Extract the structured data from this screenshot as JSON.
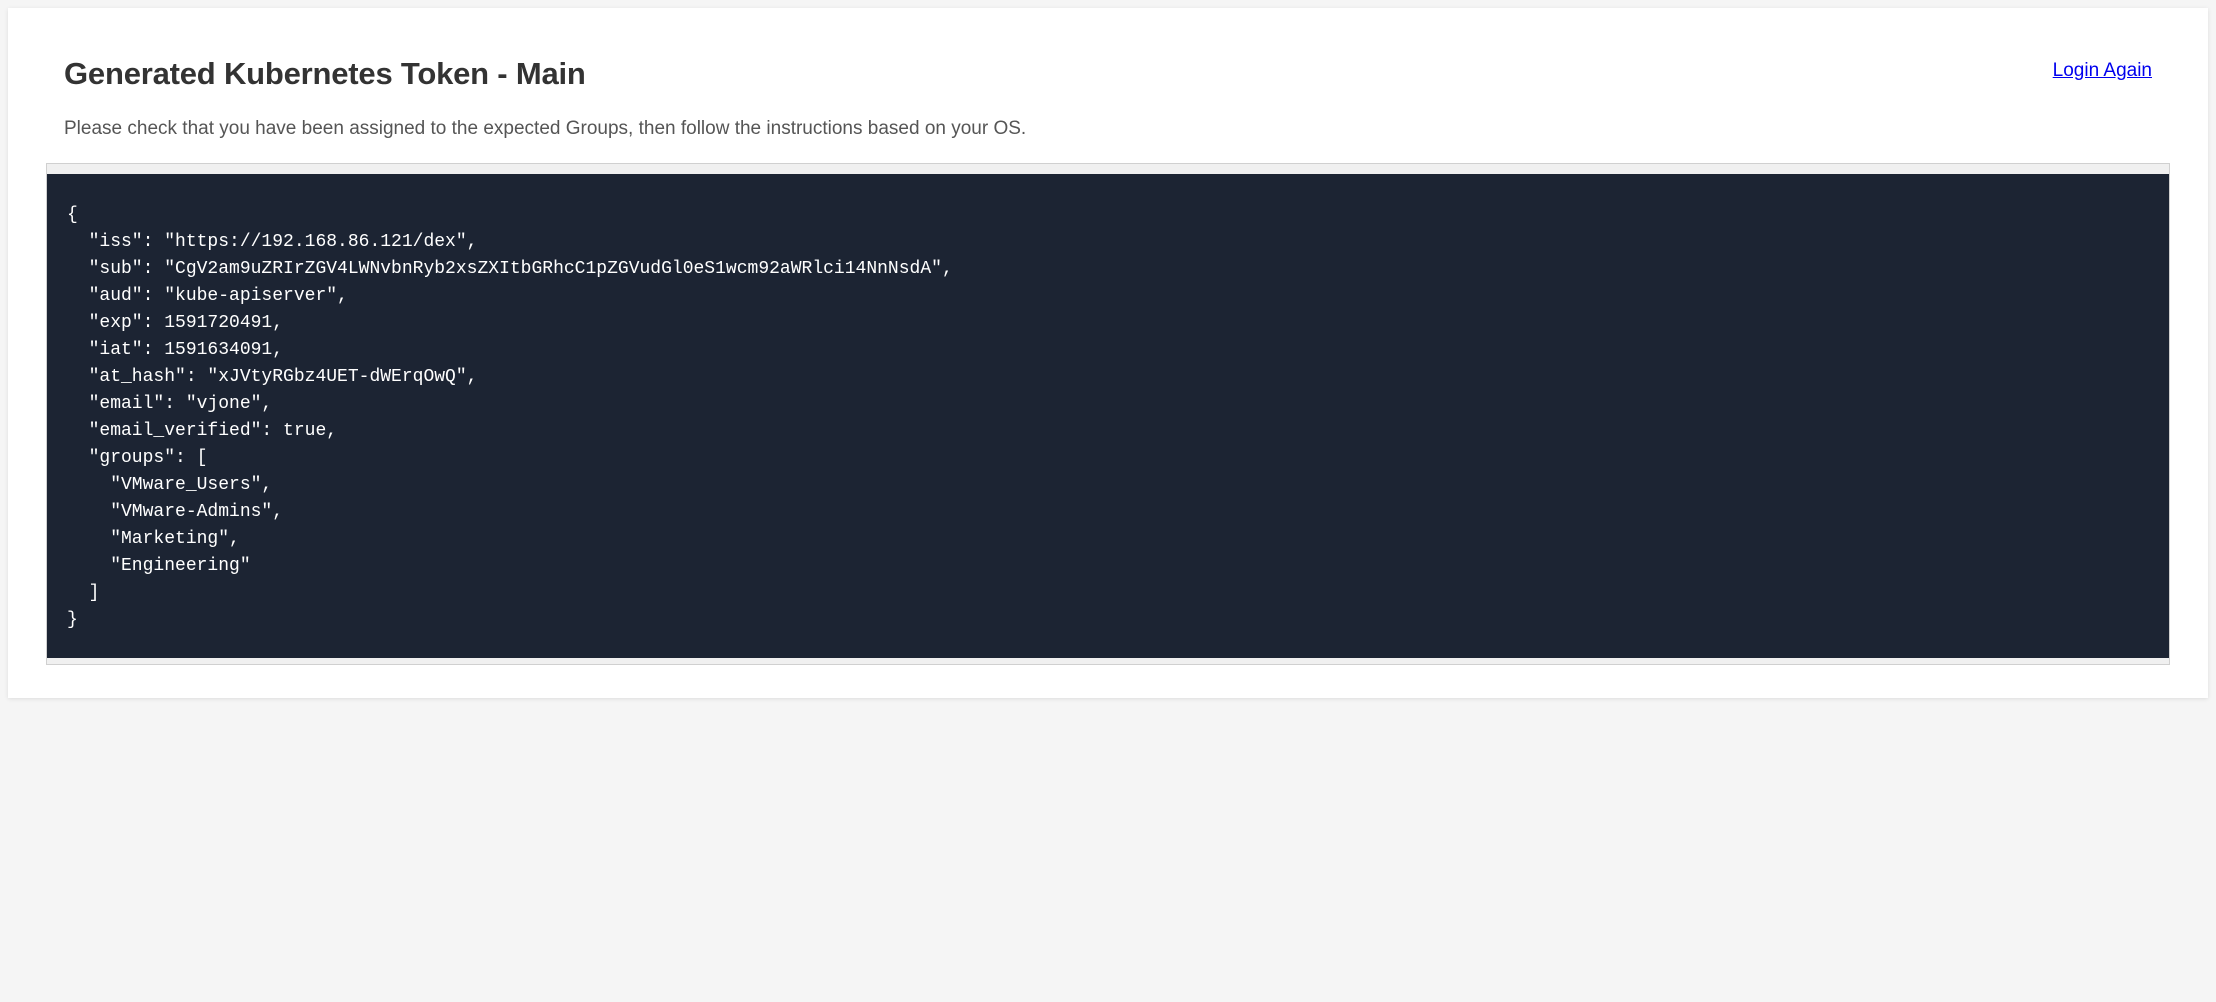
{
  "header": {
    "title": "Generated Kubernetes Token - Main",
    "login_link": "Login Again"
  },
  "description": "Please check that you have been assigned to the expected Groups, then follow the instructions based on your OS.",
  "token": {
    "iss": "https://192.168.86.121/dex",
    "sub": "CgV2am9uZRIrZGV4LWNvbnRyb2xsZXItbGRhcC1pZGVudGl0eS1wcm92aWRlci14NnNsdA",
    "aud": "kube-apiserver",
    "exp": 1591720491,
    "iat": 1591634091,
    "at_hash": "xJVtyRGbz4UET-dWErqOwQ",
    "email": "vjone",
    "email_verified": true,
    "groups": [
      "VMware_Users",
      "VMware-Admins",
      "Marketing",
      "Engineering"
    ]
  }
}
